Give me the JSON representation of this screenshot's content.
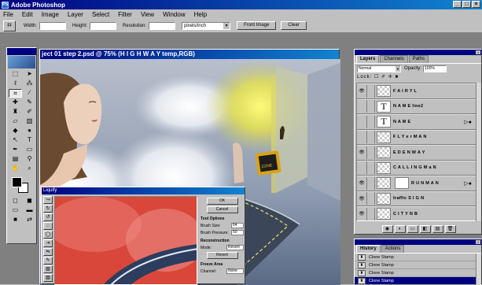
{
  "window": {
    "title": "Adobe Photoshop",
    "controls": [
      "_",
      "□",
      "×"
    ]
  },
  "menu": [
    "File",
    "Edit",
    "Image",
    "Layer",
    "Select",
    "Filter",
    "View",
    "Window",
    "Help"
  ],
  "options_bar": {
    "width_label": "Width:",
    "height_label": "Height:",
    "resolution_label": "Resolution:",
    "units_value": "pixels/inch",
    "front_image_label": "Front Image",
    "clear_label": "Clear"
  },
  "document": {
    "title": "ject 01 step 2.psd @ 75% (H I G H W A Y temp,RGB)",
    "sign_text": "ZONE"
  },
  "liquify": {
    "title": "Liquify",
    "ok_label": "OK",
    "cancel_label": "Cancel",
    "tool_options_head": "Tool Options",
    "brush_size_label": "Brush Size:",
    "brush_size_value": "64",
    "brush_pressure_label": "Brush Pressure:",
    "brush_pressure_value": "50",
    "reconstruction_head": "Reconstruction",
    "mode_label": "Mode:",
    "mode_value": "Revert",
    "revert_label": "Revert",
    "freeze_head": "Freeze Area",
    "channel_label": "Channel:",
    "channel_value": "None"
  },
  "layers_palette": {
    "tabs": [
      "Layers",
      "Channels",
      "Paths"
    ],
    "blend_mode": "Normal",
    "opacity_label": "Opacity:",
    "opacity_value": "100%",
    "lock_label": "Lock:",
    "lock_icons": "☐ ✐ ✢ ■",
    "layers": [
      {
        "name": "F A I R Y  L",
        "visible": true,
        "thumb": "checker",
        "fx": false,
        "active": false
      },
      {
        "name": "N A M E line2",
        "visible": false,
        "thumb": "text",
        "fx": false,
        "active": false
      },
      {
        "name": "N A M E",
        "visible": false,
        "thumb": "text",
        "fx": true,
        "active": false
      },
      {
        "name": "F L Y e r M A N",
        "visible": false,
        "thumb": "checker",
        "fx": false,
        "active": false
      },
      {
        "name": "E D E N  W A Y",
        "visible": true,
        "thumb": "checker",
        "fx": false,
        "active": false
      },
      {
        "name": "C A L L I N G  M a N",
        "visible": false,
        "thumb": "checker",
        "fx": false,
        "active": false
      },
      {
        "name": "R U N  M A N",
        "visible": true,
        "thumb": "mask",
        "fx": true,
        "active": false
      },
      {
        "name": "traffic S I G N",
        "visible": true,
        "thumb": "checker",
        "fx": false,
        "active": false
      },
      {
        "name": "C I T Y  N B",
        "visible": true,
        "thumb": "checker",
        "fx": false,
        "active": false
      },
      {
        "name": "H I G H W A Y  temp",
        "visible": true,
        "thumb": "road",
        "fx": false,
        "active": true
      }
    ],
    "bottom_buttons": [
      "◉",
      "◐",
      "▭",
      "◧",
      "▤",
      "🗑"
    ]
  },
  "history_palette": {
    "tabs": [
      "History",
      "Actions"
    ],
    "items": [
      "Clone Stamp",
      "Clone Stamp",
      "Clone Stamp",
      "Clone Stamp"
    ]
  },
  "colors": {
    "title_blue": "#000080",
    "liquify_preview": "#d34a3a"
  }
}
